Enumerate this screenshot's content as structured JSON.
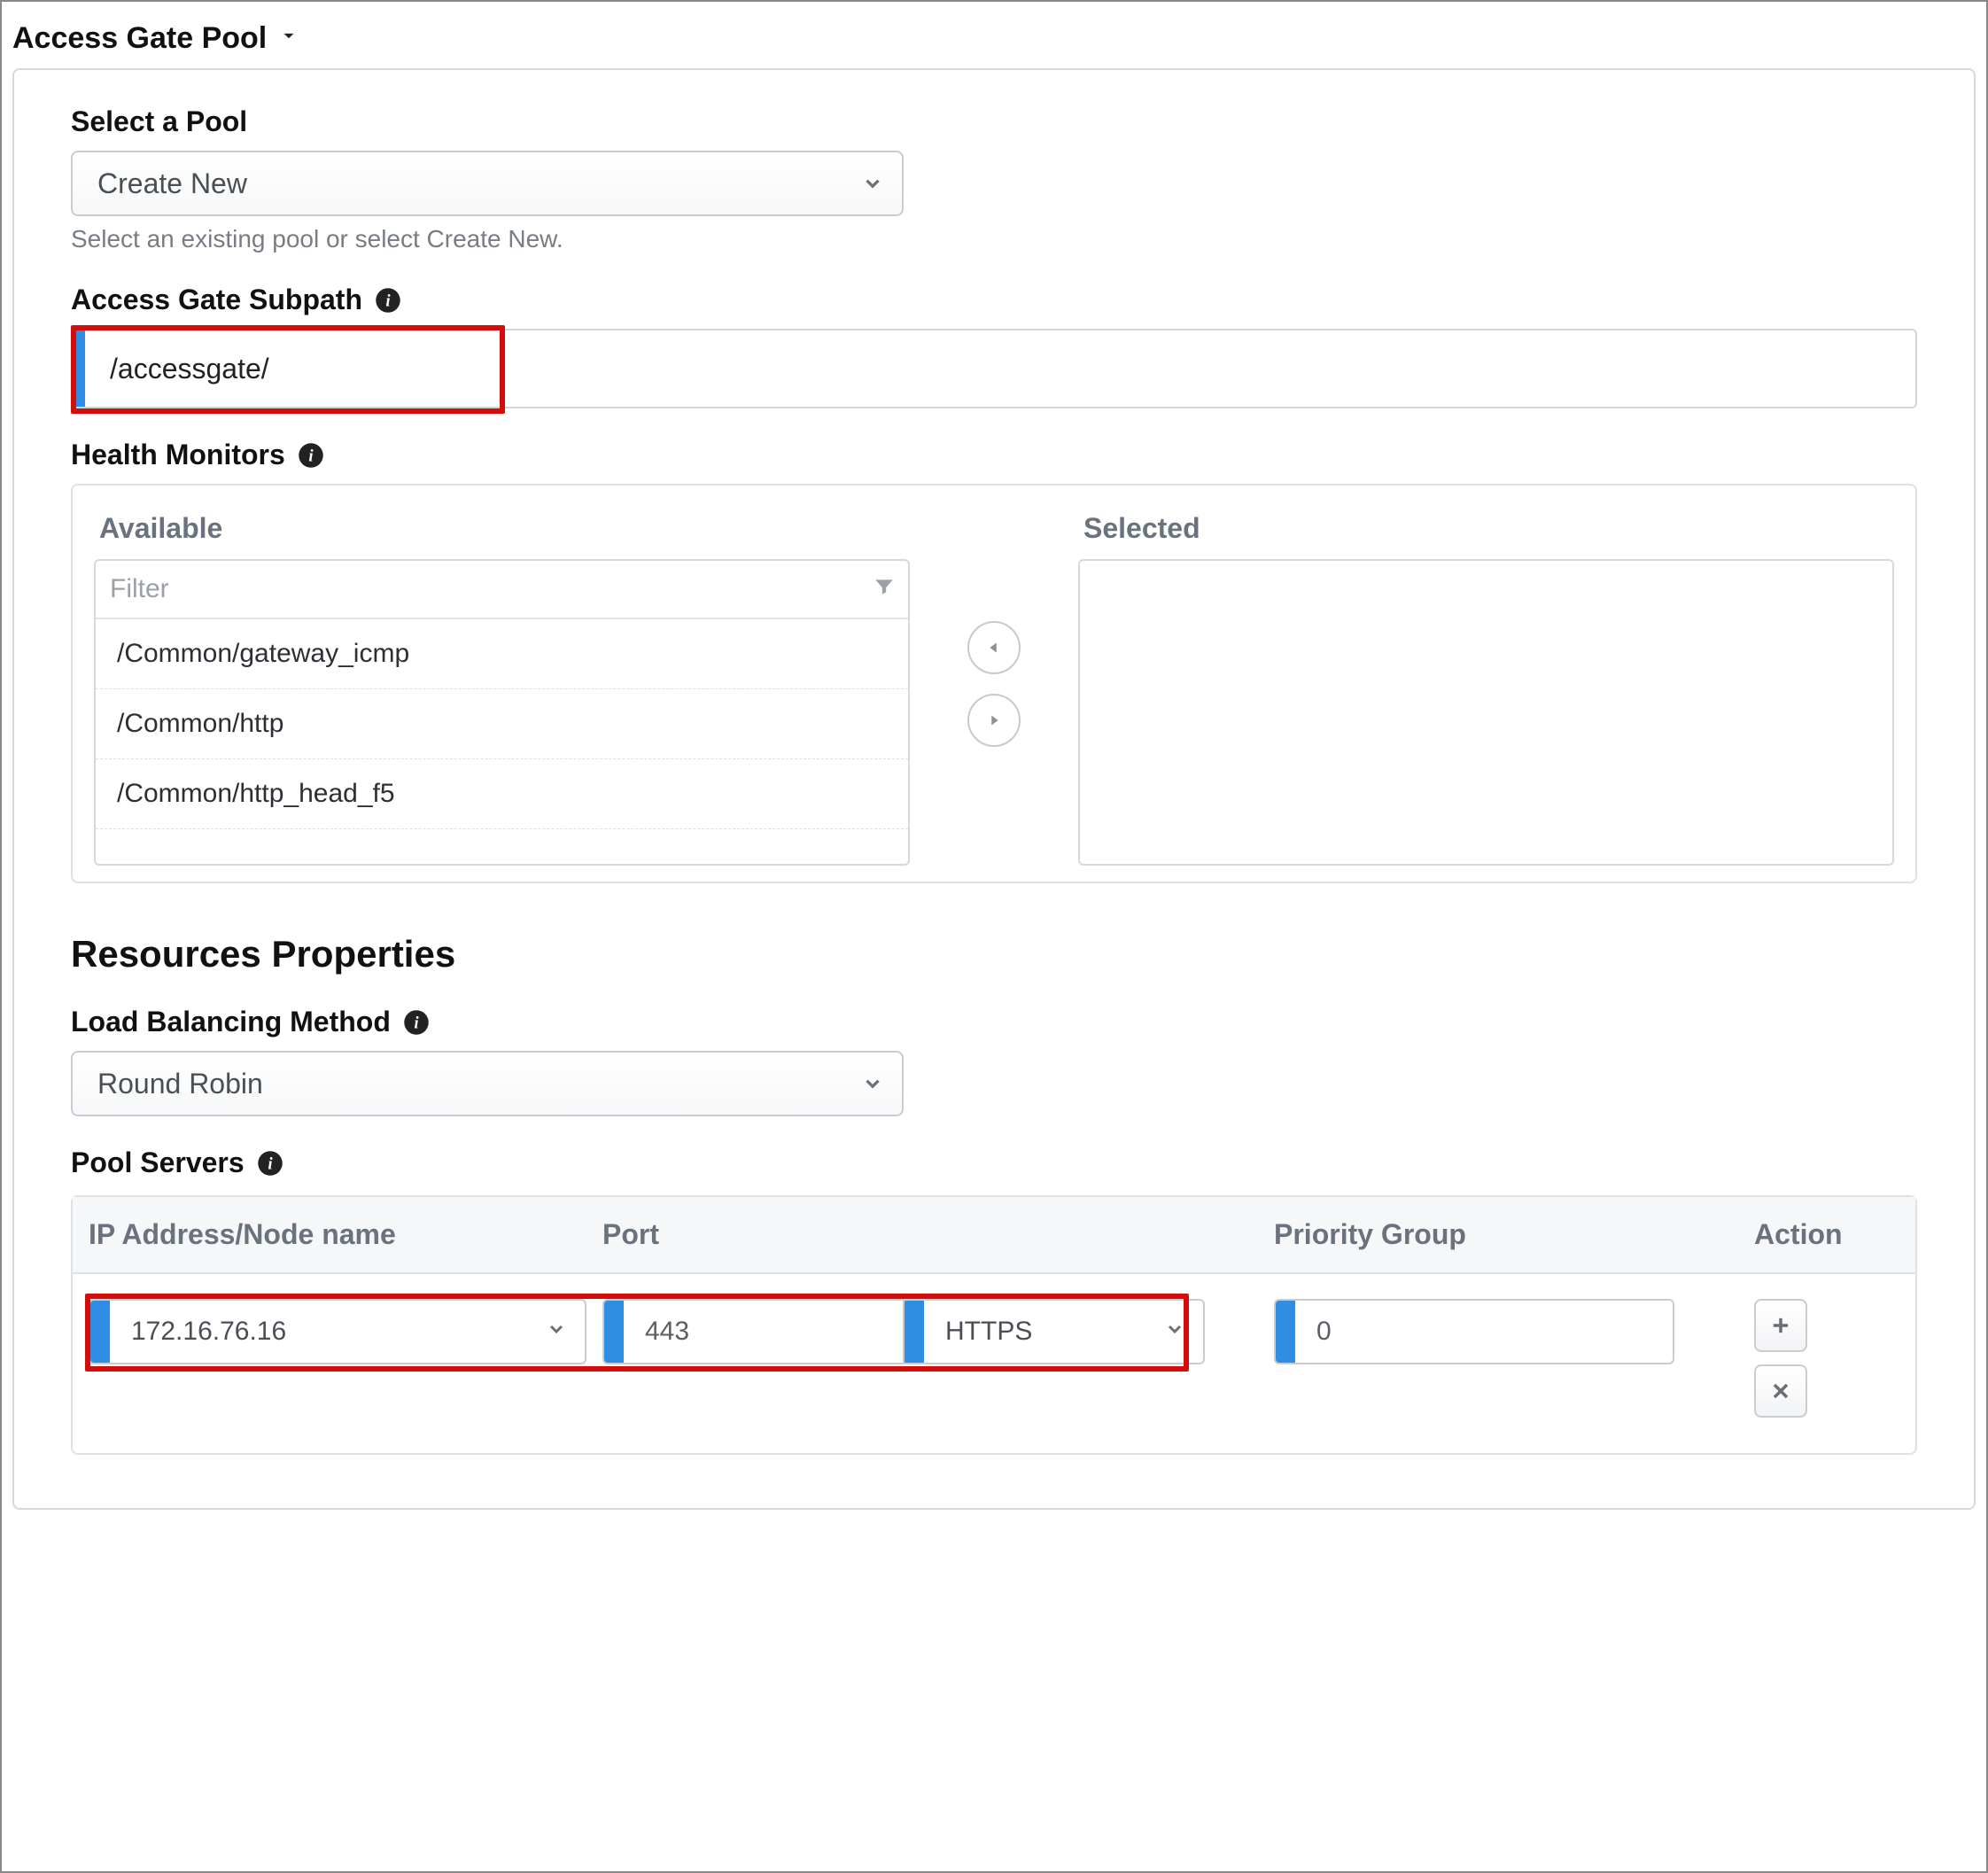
{
  "section": {
    "title": "Access Gate Pool"
  },
  "selectPool": {
    "label": "Select a Pool",
    "value": "Create New",
    "helper": "Select an existing pool or select Create New."
  },
  "subpath": {
    "label": "Access Gate Subpath",
    "value": "/accessgate/"
  },
  "healthMonitors": {
    "label": "Health Monitors",
    "availableTitle": "Available",
    "selectedTitle": "Selected",
    "filterPlaceholder": "Filter",
    "available": [
      "/Common/gateway_icmp",
      "/Common/http",
      "/Common/http_head_f5"
    ],
    "selected": []
  },
  "resources": {
    "heading": "Resources Properties"
  },
  "lbMethod": {
    "label": "Load Balancing Method",
    "value": "Round Robin"
  },
  "poolServers": {
    "label": "Pool Servers",
    "headers": {
      "ip": "IP Address/Node name",
      "port": "Port",
      "priority": "Priority Group",
      "action": "Action"
    },
    "rows": [
      {
        "ip": "172.16.76.16",
        "port": "443",
        "protocol": "HTTPS",
        "priority": "0"
      }
    ]
  }
}
